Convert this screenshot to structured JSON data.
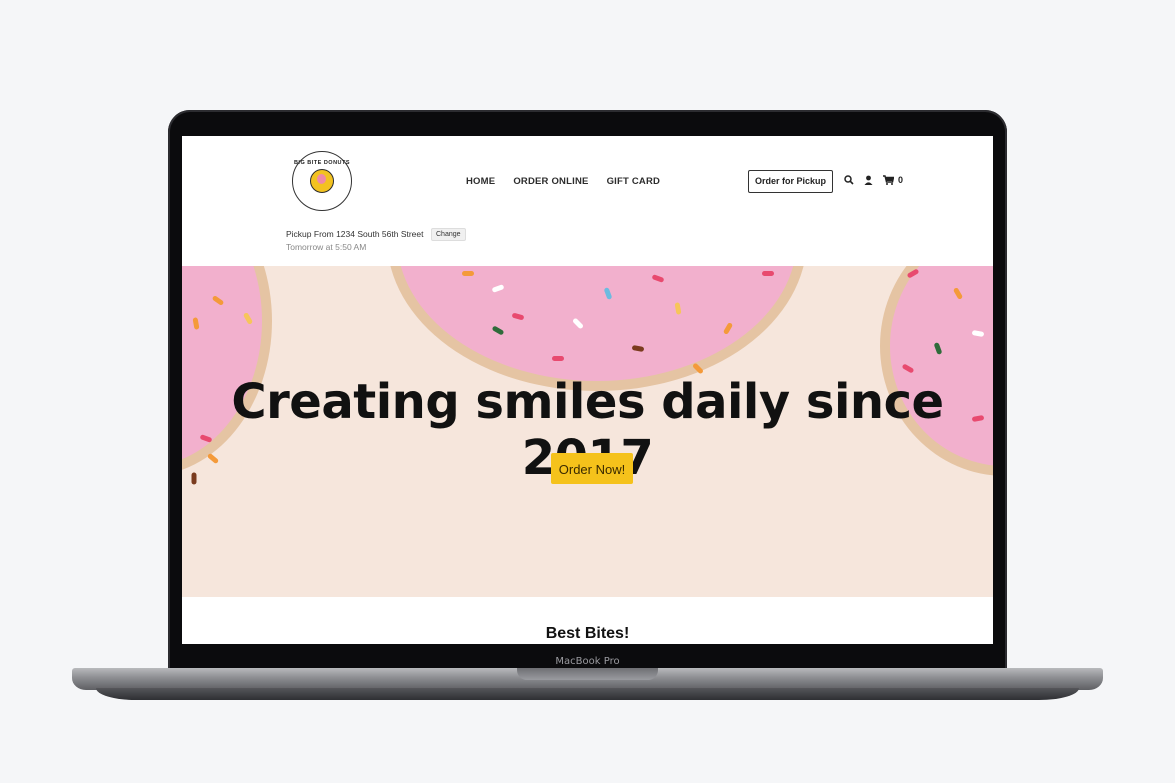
{
  "device": {
    "label": "MacBook Pro"
  },
  "site": {
    "logo_text": "BIG BITE DONUTS",
    "nav": [
      {
        "label": "HOME"
      },
      {
        "label": "ORDER ONLINE"
      },
      {
        "label": "GIFT CARD"
      }
    ],
    "order_for_pickup": "Order for Pickup",
    "cart_count": "0",
    "icons": [
      "search-icon",
      "user-icon",
      "cart-icon"
    ],
    "pickup": {
      "from": "Pickup From 1234 South 56th Street",
      "change": "Change",
      "time": "Tomorrow at 5:50 AM"
    }
  },
  "hero": {
    "title": "Creating smiles daily since 2017",
    "cta": "Order Now!",
    "cta_color": "#f5c21b",
    "background_color": "#f6e6dc"
  },
  "section": {
    "title": "Best Bites!"
  }
}
